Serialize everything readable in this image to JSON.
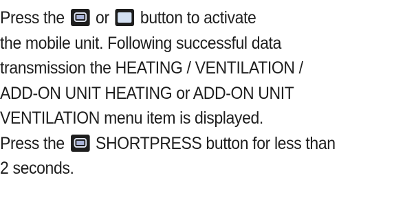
{
  "instructions": {
    "line1": {
      "prefix": "Press the",
      "connector": "or",
      "suffix": "button to activate"
    },
    "line2": "the mobile unit. Following successful data",
    "line3": "transmission the HEATING / VENTILATION /",
    "line4": "ADD-ON UNIT HEATING or ADD-ON UNIT",
    "line5": "VENTILATION menu item is displayed.",
    "line6": {
      "prefix": "Press the",
      "suffix": "SHORTPRESS button for less than"
    },
    "line7": "2 seconds."
  },
  "icons": {
    "short_press": "shortpress-button-icon",
    "long_press": "longpress-button-icon"
  },
  "colors": {
    "text": "#1e1e1e",
    "icon_body": "#1e1e1e",
    "icon_face": "#d3e0f2"
  }
}
